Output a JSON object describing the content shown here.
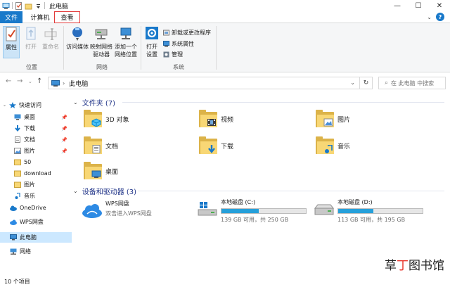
{
  "window": {
    "title": "此电脑",
    "min": "—",
    "max": "☐",
    "close": "✕"
  },
  "tabs": {
    "file": "文件",
    "computer": "计算机",
    "view": "查看"
  },
  "ribbon": {
    "location": {
      "label": "位置",
      "properties": "属性",
      "open": "打开",
      "rename": "重命名"
    },
    "network": {
      "label": "网络",
      "media": "访问媒体",
      "map1": "映射网络",
      "map2": "驱动器",
      "add1": "添加一个",
      "add2": "网络位置"
    },
    "system": {
      "label": "系统",
      "open1": "打开",
      "open2": "设置",
      "uninstall": "卸载或更改程序",
      "sysprops": "系统属性",
      "manage": "管理"
    }
  },
  "address": {
    "crumb": "此电脑",
    "search_placeholder": "在 此电脑 中搜索"
  },
  "nav": {
    "quick_access": "快速访问",
    "quick_items": [
      {
        "label": "桌面",
        "pinned": true
      },
      {
        "label": "下载",
        "pinned": true
      },
      {
        "label": "文档",
        "pinned": true
      },
      {
        "label": "图片",
        "pinned": true
      },
      {
        "label": "50",
        "pinned": false
      },
      {
        "label": "download",
        "pinned": false
      },
      {
        "label": "图片",
        "pinned": false
      },
      {
        "label": "音乐",
        "pinned": false
      }
    ],
    "onedrive": "OneDrive",
    "wps": "WPS网盘",
    "this_pc": "此电脑",
    "network": "网络",
    "pin_glyph": "📌"
  },
  "folders_header": "文件夹 (7)",
  "folders": [
    {
      "name": "3D 对象"
    },
    {
      "name": "视频"
    },
    {
      "name": "图片"
    },
    {
      "name": "文档"
    },
    {
      "name": "下载"
    },
    {
      "name": "音乐"
    },
    {
      "name": "桌面"
    }
  ],
  "devices_header": "设备和驱动器 (3)",
  "devices": {
    "wps": {
      "name": "WPS网盘",
      "sub": "双击进入WPS网盘"
    },
    "c": {
      "name": "本地磁盘 (C:)",
      "free": "139 GB 可用，共 250 GB",
      "used_fraction": 0.444
    },
    "d": {
      "name": "本地磁盘 (D:)",
      "free": "113 GB 可用，共 195 GB",
      "used_fraction": 0.42
    }
  },
  "status": "10 个项目",
  "watermark": {
    "a": "草",
    "b": "丁",
    "c": "图书馆"
  }
}
